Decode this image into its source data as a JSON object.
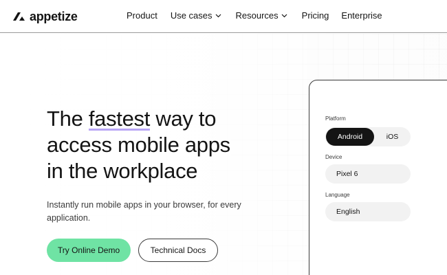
{
  "brand": {
    "name": "appetize"
  },
  "nav": {
    "items": [
      {
        "label": "Product",
        "has_dropdown": false
      },
      {
        "label": "Use cases",
        "has_dropdown": true
      },
      {
        "label": "Resources",
        "has_dropdown": true
      },
      {
        "label": "Pricing",
        "has_dropdown": false
      },
      {
        "label": "Enterprise",
        "has_dropdown": false
      }
    ]
  },
  "hero": {
    "headline_pre": "The ",
    "headline_highlight": "fastest",
    "headline_post_line1": " way to",
    "headline_line2": "access mobile apps",
    "headline_line3": "in the workplace",
    "subtext": "Instantly run mobile apps in your browser, for every application.",
    "primary_button": "Try Online Demo",
    "secondary_button": "Technical Docs"
  },
  "panel": {
    "platform_label": "Platform",
    "platform_options": [
      "Android",
      "iOS"
    ],
    "platform_selected": "Android",
    "device_label": "Device",
    "device_value": "Pixel 6",
    "language_label": "Language",
    "language_value": "English"
  },
  "colors": {
    "accent_green": "#6fe3a4",
    "highlight_purple": "#b9a6f6",
    "text_dark": "#141414"
  }
}
